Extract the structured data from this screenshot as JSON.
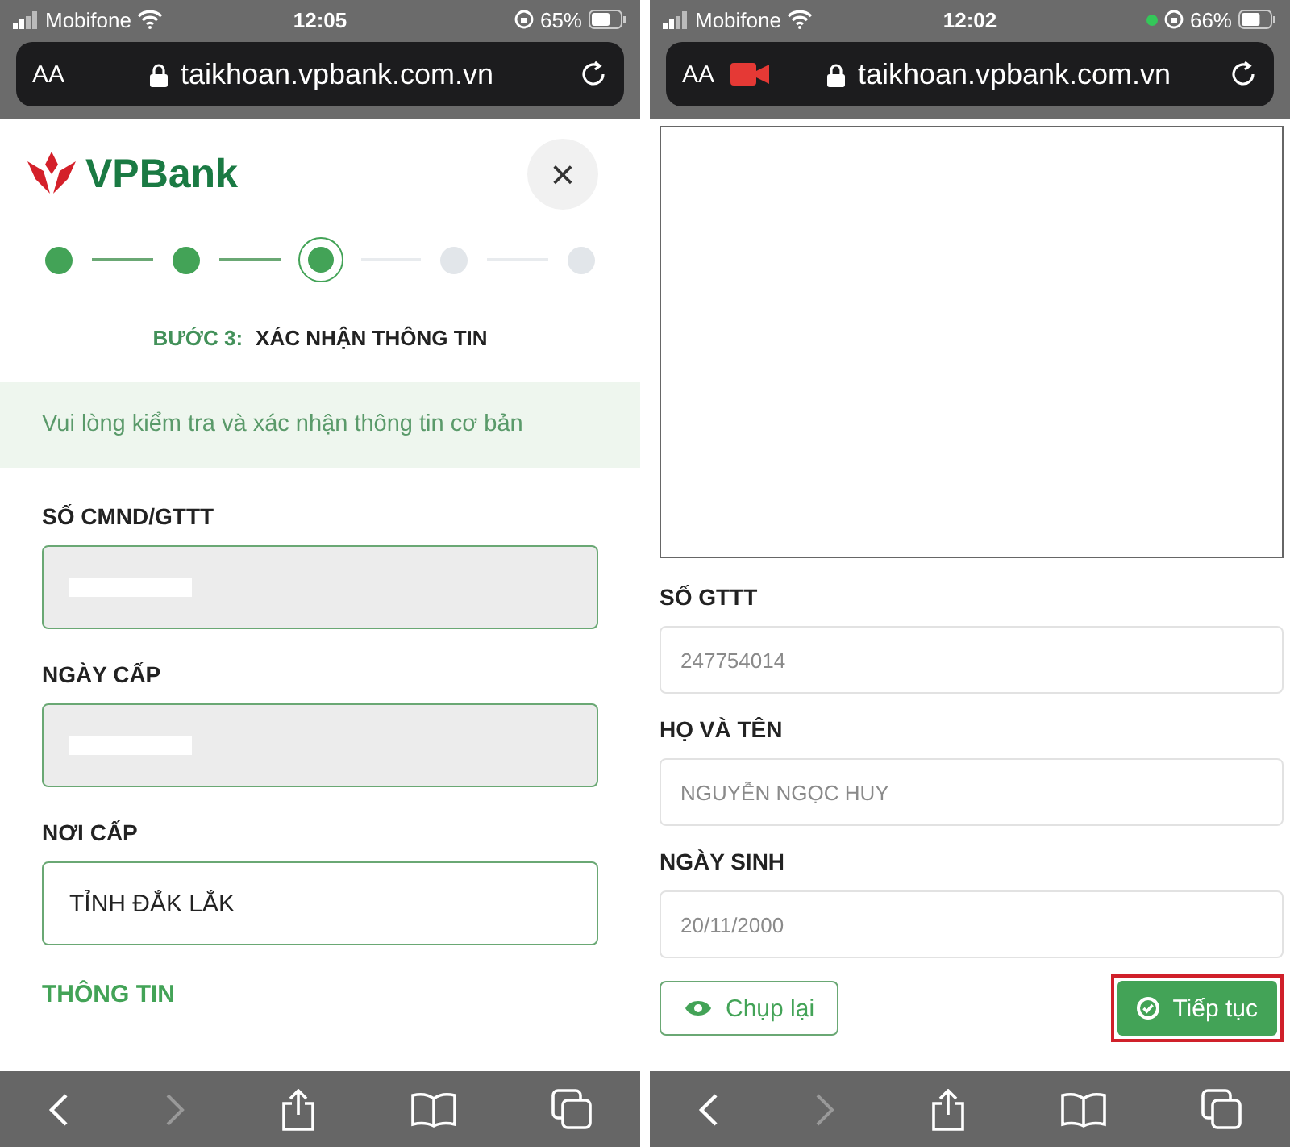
{
  "phones": [
    {
      "status_bar": {
        "carrier": "Mobifone",
        "time": "12:05",
        "battery": "65%",
        "level": 0.65
      },
      "address_bar": {
        "text_size": "AA",
        "url": "taikhoan.vpbank.com.vn"
      },
      "page": {
        "kind": "form",
        "logo": "VPBank",
        "close": "×",
        "steps": [
          {
            "completed": true,
            "selected": false
          },
          {
            "completed": true,
            "selected": false
          },
          {
            "completed": true,
            "selected": true
          },
          {
            "completed": false,
            "selected": false
          },
          {
            "completed": false,
            "selected": false
          }
        ],
        "step_label": "BƯỚC 3:",
        "step_title": "XÁC NHẬN THÔNG TIN",
        "notice": "Vui lòng kiểm tra và xác nhận thông tin cơ bản",
        "fields": [
          {
            "label": "SỐ CMND/GTTT",
            "disabled": true,
            "redacted": true
          },
          {
            "label": "NGÀY CẤP",
            "disabled": true,
            "redacted": true
          },
          {
            "label": "NƠI CẤP",
            "disabled": false,
            "value": "TỈNH ĐẮK LẮK"
          }
        ],
        "section": "THÔNG TIN"
      }
    },
    {
      "status_bar": {
        "carrier": "Mobifone",
        "time": "12:02",
        "battery": "66%",
        "level": 0.66,
        "camera_in_use": true
      },
      "address_bar": {
        "text_size": "AA",
        "url": "taikhoan.vpbank.com.vn",
        "recording": true
      },
      "page": {
        "kind": "scan",
        "fields": [
          {
            "label": "SỐ GTTT",
            "value": "247754014"
          },
          {
            "label": "HỌ VÀ TÊN",
            "value": "NGUYỄN NGỌC HUY"
          },
          {
            "label": "NGÀY SINH",
            "value": "20/11/2000"
          }
        ],
        "retake": "Chụp lại",
        "continue": {
          "label": "Tiếp tục",
          "highlighted": true
        }
      }
    }
  ]
}
